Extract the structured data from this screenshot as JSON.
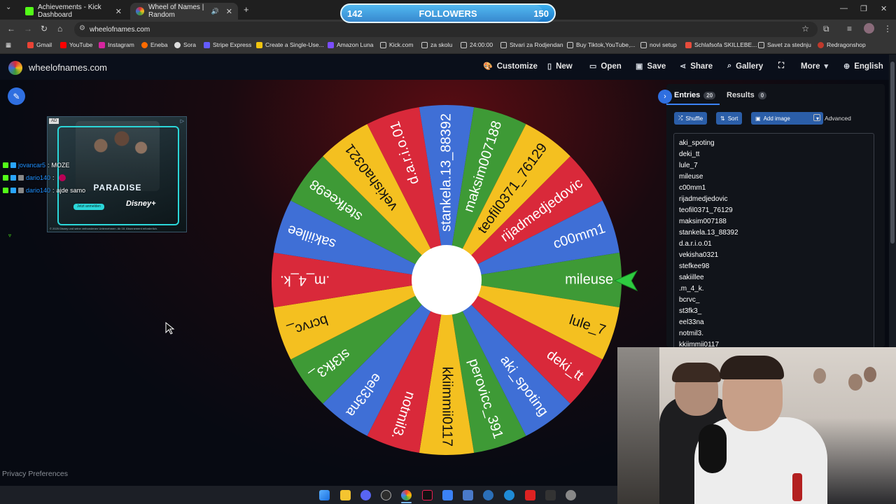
{
  "browser": {
    "tabs": [
      {
        "label": "Achievements - Kick Dashboard",
        "active": false,
        "color": "#53fc18"
      },
      {
        "label": "Wheel of Names | Random",
        "active": true,
        "color": "#e8b100"
      }
    ],
    "url": "wheelofnames.com",
    "bookmarks": [
      "Gmail",
      "YouTube",
      "Instagram",
      "Eneba",
      "Sora",
      "Stripe Express",
      "Create a Single-Use...",
      "Amazon Luna",
      "Kick.com",
      "za skolu",
      "24:00:00",
      "Stvari za Rodjendan",
      "Buy Tiktok,YouTube,...",
      "novi setup",
      "Schlafsofa SKILLEBE...",
      "Savet za stednju",
      "Redragonshop"
    ]
  },
  "followers": {
    "current": "142",
    "label": "FOLLOWERS",
    "goal": "150",
    "progress": 0.947
  },
  "site": {
    "logo_text": "wheelofnames.com",
    "menu": [
      "Customize",
      "New",
      "Open",
      "Save",
      "Share",
      "Gallery",
      "More",
      "English"
    ]
  },
  "ad": {
    "tag": "AD",
    "title": "PARADISE",
    "button": "Jetzt anmelden",
    "brand": "Disney+",
    "fine": "© 2025 Disney und seine verbundenen Unternehmen. Ab 18. Abonnement erforderlich."
  },
  "chat": [
    {
      "user": "jovancar5",
      "message": "MOZE"
    },
    {
      "user": "dario140",
      "message": ""
    },
    {
      "user": "dario140",
      "message": "ajde samo"
    }
  ],
  "panel": {
    "entries_tab": "Entries",
    "entries_count": "20",
    "results_tab": "Results",
    "results_count": "0",
    "shuffle": "Shuffle",
    "sort": "Sort",
    "add_image": "Add image",
    "advanced": "Advanced",
    "entries": [
      "aki_spoting",
      "deki_tt",
      "lule_7",
      "mileuse",
      "c00mm1",
      "rijadmedjedovic",
      "teofil0371_76129",
      "maksim007188",
      "stankela.13_88392",
      "d.a.r.i.o.01",
      "vekisha0321",
      "stefkee98",
      "sakiillee",
      ".m_4_k.",
      "bcrvc_",
      "st3fk3_",
      "eel33na",
      "notmil3.",
      "kkiimmii0117"
    ]
  },
  "wheel": {
    "segments": [
      "mileuse",
      "lule_7",
      "deki_tt",
      "aki_spoting",
      "perovicc_391",
      "kkiimmii0117",
      "notmil3.",
      "eel33na",
      "st3fk3_",
      "bcrvc_",
      ".m_4_k.",
      "sakiillee",
      "stefkee98",
      "vekisha0321",
      "d.a.r.i.o.01",
      "stankela.13_88392",
      "maksim007188",
      "teofil0371_76129",
      "rijadmedjedovic",
      "c00mm1"
    ],
    "colors": [
      "#3e9a36",
      "#f4c020",
      "#d9293a",
      "#3f6fd6"
    ]
  },
  "privacy": "Privacy Preferences"
}
